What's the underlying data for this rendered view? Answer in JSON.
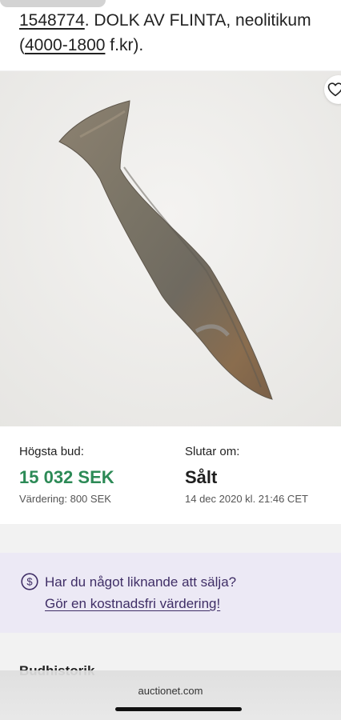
{
  "header": {
    "lot_number": "1548774",
    "title_part1": ". DOLK AV FLINTA, neolitikum",
    "paren_open": "(",
    "period_link": "4000-1800",
    "title_part2": " f.kr)."
  },
  "gallery": {
    "image_subject": "flint dagger",
    "favorite_icon": "heart-icon",
    "dots_total": 2,
    "dot_active_index": 0
  },
  "bid": {
    "highest_bid_label": "Högsta bud:",
    "highest_bid_value": "15 032 SEK",
    "valuation": "Värdering: 800 SEK",
    "ends_label": "Slutar om:",
    "ends_value": "Sålt",
    "end_date": "14 dec 2020 kl. 21:46 CET"
  },
  "sell": {
    "icon": "dollar-circle-icon",
    "question": "Har du något liknande att sälja?",
    "link": "Gör en kostnadsfri värdering!"
  },
  "history": {
    "heading": "Budhistorik"
  },
  "browser": {
    "url": "auctionet.com"
  },
  "colors": {
    "accent_green": "#2c8a56",
    "sell_bg": "#ece9f5",
    "sell_text": "#3f2e66"
  }
}
